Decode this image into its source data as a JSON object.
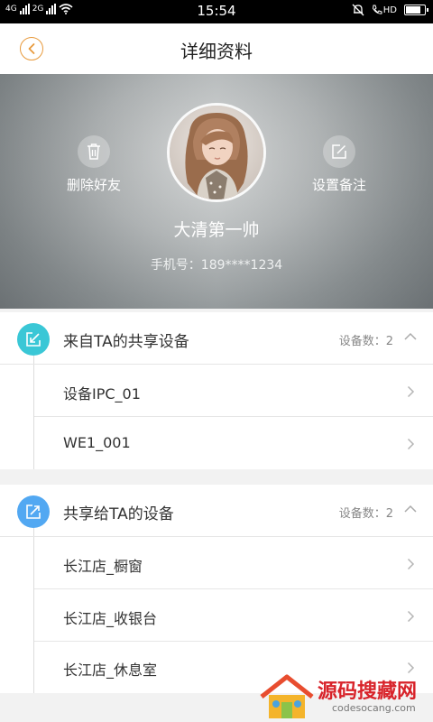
{
  "status_bar": {
    "network_1": "4G",
    "network_2": "2G",
    "time": "15:54",
    "hd_label": "HD",
    "battery_level": 0.85
  },
  "header": {
    "title": "详细资料",
    "back_icon": "chevron-left-icon",
    "accent_color": "#e89a3c"
  },
  "profile": {
    "delete_friend_label": "删除好友",
    "delete_icon": "trash-icon",
    "set_note_label": "设置备注",
    "note_icon": "edit-icon",
    "name": "大清第一帅",
    "phone": "手机号：189****1234"
  },
  "shared_from": {
    "title": "来自TA的共享设备",
    "icon": "share-in-icon",
    "icon_color": "#3ac7d6",
    "count_label": "设备数：2",
    "items": [
      {
        "label": "设备IPC_01"
      },
      {
        "label": "WE1_001"
      }
    ]
  },
  "shared_to": {
    "title": "共享给TA的设备",
    "icon": "share-out-icon",
    "icon_color": "#52a8f2",
    "count_label": "设备数：2",
    "items": [
      {
        "label": "长江店_橱窗"
      },
      {
        "label": "长江店_收银台"
      },
      {
        "label": "长江店_休息室"
      }
    ]
  },
  "watermark": {
    "text": "源码搜藏网",
    "url": "codesocang.com"
  }
}
